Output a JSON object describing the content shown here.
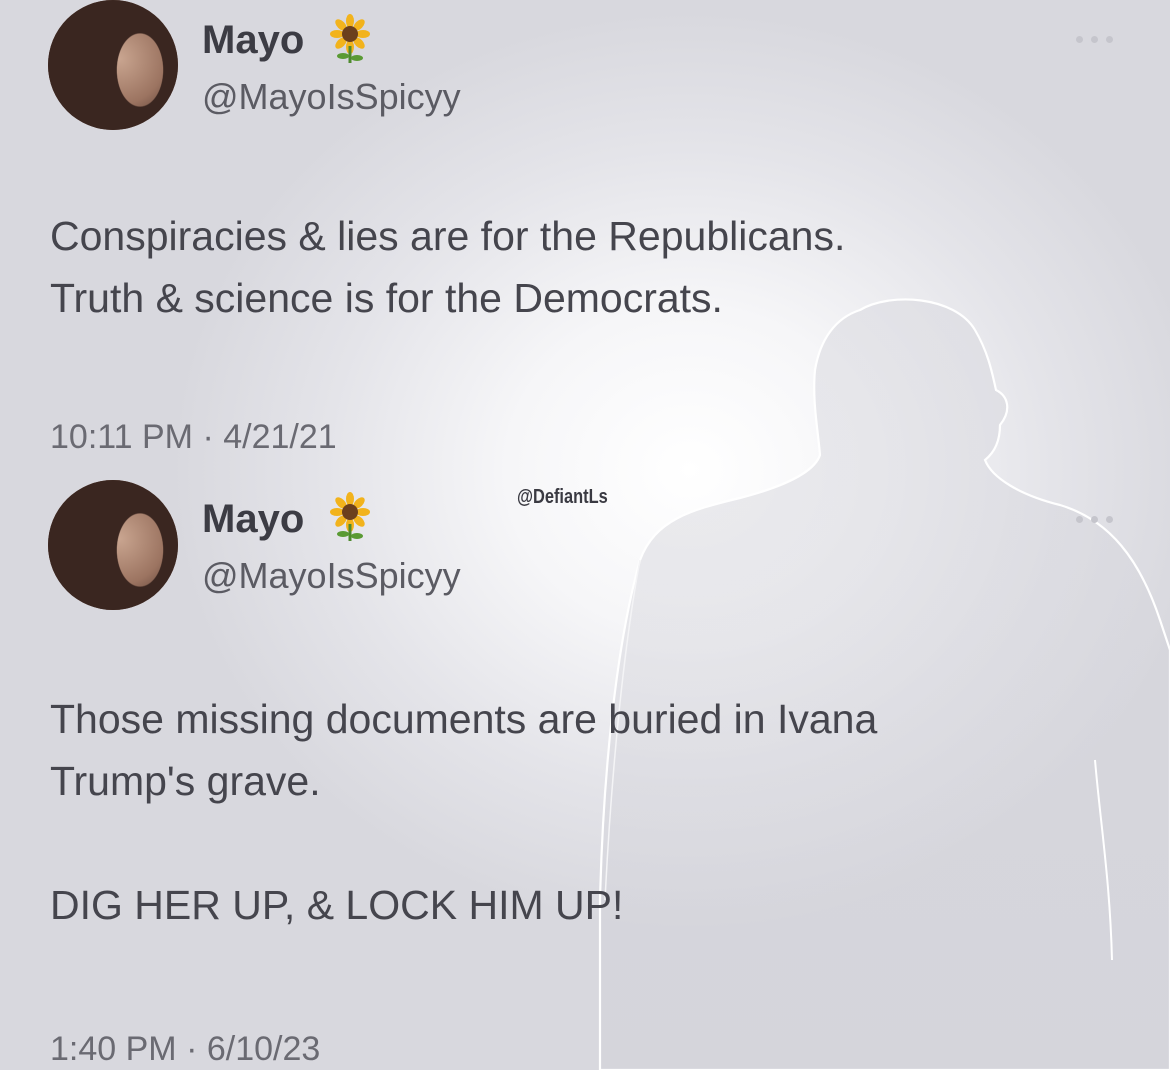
{
  "tweets": [
    {
      "display_name": "Mayo",
      "handle": "@MayoIsSpicyy",
      "text_lines": [
        "Conspiracies & lies are for the Republicans.",
        "Truth & science is for the Democrats."
      ],
      "timestamp": "10:11 PM · 4/21/21",
      "icon": "sunflower-emoji"
    },
    {
      "display_name": "Mayo",
      "handle": "@MayoIsSpicyy",
      "text_lines": [
        "Those missing documents are buried in Ivana",
        "Trump's grave.",
        "",
        "DIG HER UP, & LOCK HIM UP!"
      ],
      "timestamp": "1:40 PM · 6/10/23",
      "icon": "sunflower-emoji"
    }
  ],
  "watermark": "@DefiantLs",
  "colors": {
    "text": "#45454d",
    "muted": "#6a6a72",
    "sunflower_petals": "#f2b31c",
    "sunflower_center": "#6b3f1d"
  }
}
